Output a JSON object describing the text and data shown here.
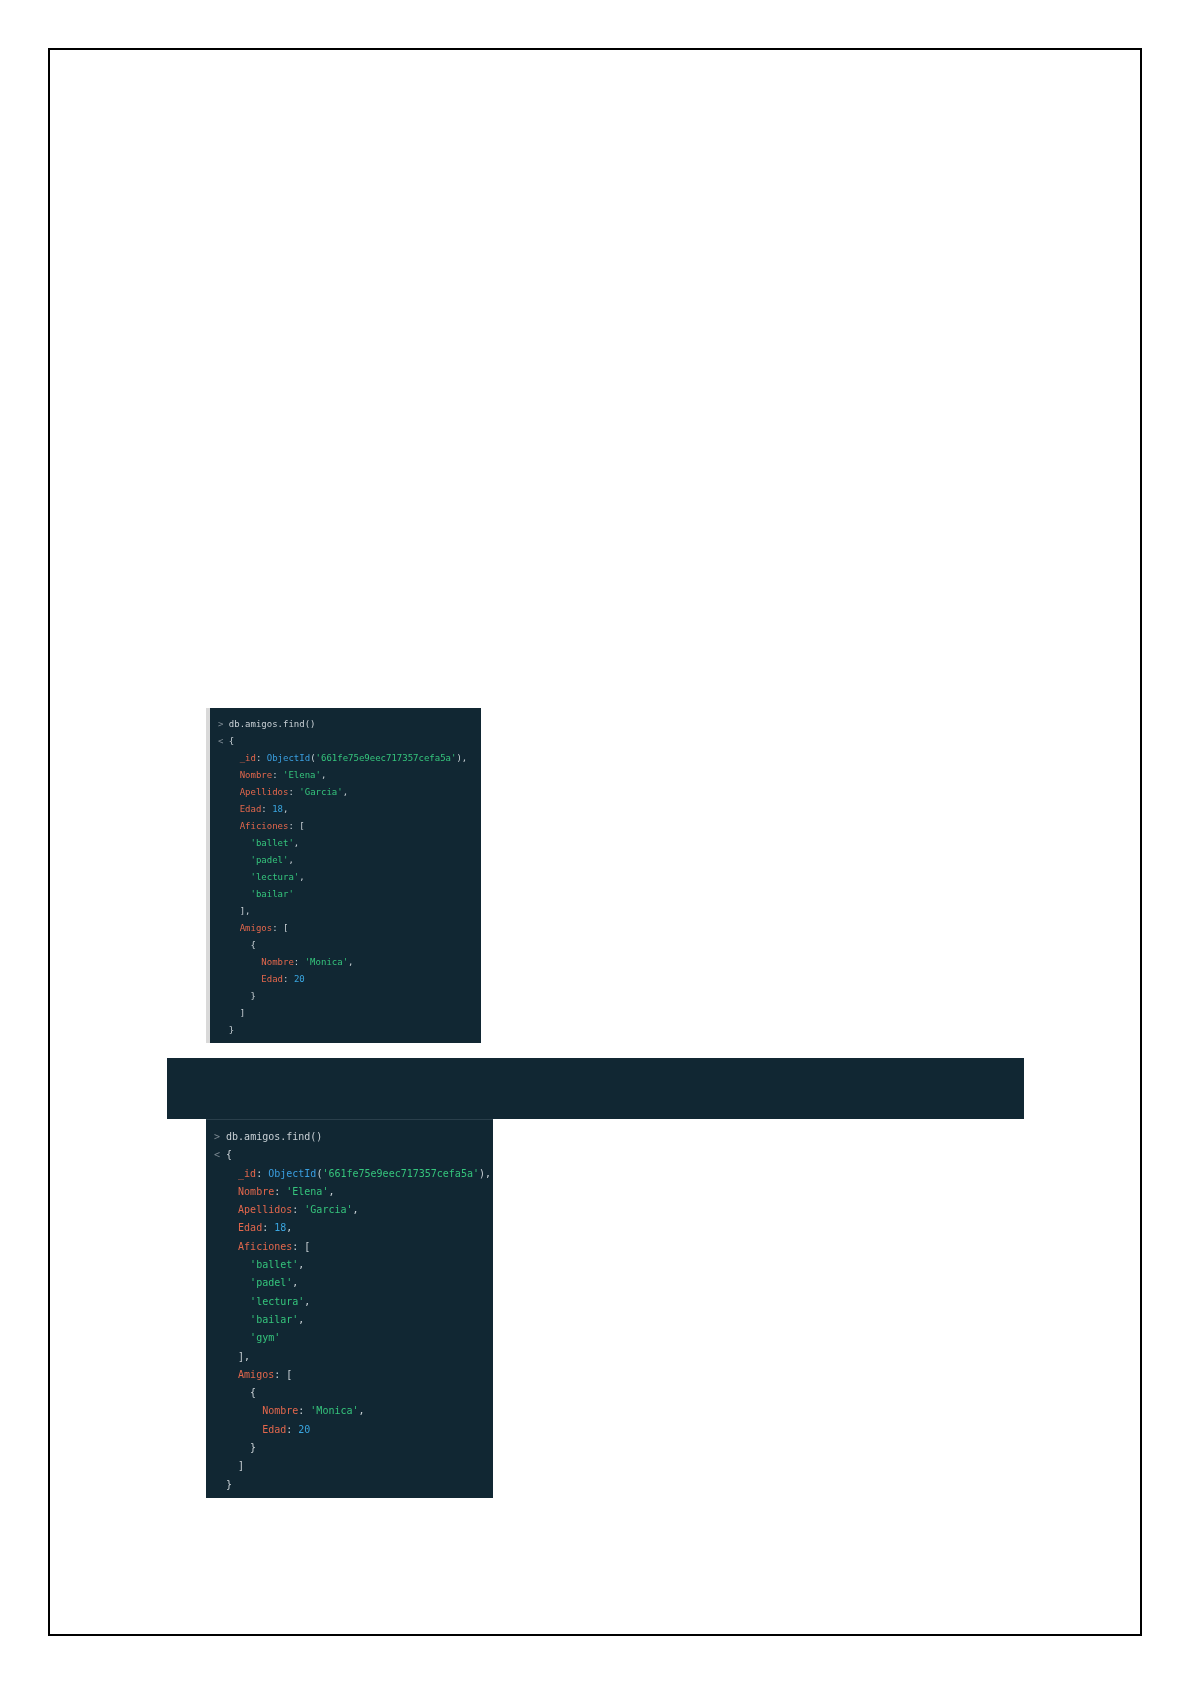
{
  "screenshots": [
    {
      "lines": [
        [
          {
            "kind": "prompt",
            "text": ">"
          },
          {
            "kind": "plain",
            "text": " db.amigos.find()"
          }
        ],
        [
          {
            "kind": "prompt",
            "text": "<"
          },
          {
            "kind": "plain",
            "text": " {"
          }
        ],
        [
          {
            "kind": "key",
            "text": "    _id"
          },
          {
            "kind": "plain",
            "text": ": "
          },
          {
            "kind": "func",
            "text": "ObjectId"
          },
          {
            "kind": "plain",
            "text": "("
          },
          {
            "kind": "string",
            "text": "'661fe75e9eec717357cefa5a'"
          },
          {
            "kind": "plain",
            "text": "),"
          }
        ],
        [
          {
            "kind": "key",
            "text": "    Nombre"
          },
          {
            "kind": "plain",
            "text": ": "
          },
          {
            "kind": "string",
            "text": "'Elena'"
          },
          {
            "kind": "plain",
            "text": ","
          }
        ],
        [
          {
            "kind": "key",
            "text": "    Apellidos"
          },
          {
            "kind": "plain",
            "text": ": "
          },
          {
            "kind": "string",
            "text": "'Garcia'"
          },
          {
            "kind": "plain",
            "text": ","
          }
        ],
        [
          {
            "kind": "key",
            "text": "    Edad"
          },
          {
            "kind": "plain",
            "text": ": "
          },
          {
            "kind": "number",
            "text": "18"
          },
          {
            "kind": "plain",
            "text": ","
          }
        ],
        [
          {
            "kind": "key",
            "text": "    Aficiones"
          },
          {
            "kind": "plain",
            "text": ": ["
          }
        ],
        [
          {
            "kind": "string",
            "text": "      'ballet'"
          },
          {
            "kind": "plain",
            "text": ","
          }
        ],
        [
          {
            "kind": "string",
            "text": "      'padel'"
          },
          {
            "kind": "plain",
            "text": ","
          }
        ],
        [
          {
            "kind": "string",
            "text": "      'lectura'"
          },
          {
            "kind": "plain",
            "text": ","
          }
        ],
        [
          {
            "kind": "string",
            "text": "      'bailar'"
          }
        ],
        [
          {
            "kind": "plain",
            "text": "    ],"
          }
        ],
        [
          {
            "kind": "key",
            "text": "    Amigos"
          },
          {
            "kind": "plain",
            "text": ": ["
          }
        ],
        [
          {
            "kind": "plain",
            "text": "      {"
          }
        ],
        [
          {
            "kind": "key",
            "text": "        Nombre"
          },
          {
            "kind": "plain",
            "text": ": "
          },
          {
            "kind": "string",
            "text": "'Monica'"
          },
          {
            "kind": "plain",
            "text": ","
          }
        ],
        [
          {
            "kind": "key",
            "text": "        Edad"
          },
          {
            "kind": "plain",
            "text": ": "
          },
          {
            "kind": "number",
            "text": "20"
          }
        ],
        [
          {
            "kind": "plain",
            "text": "      }"
          }
        ],
        [
          {
            "kind": "plain",
            "text": "    ]"
          }
        ],
        [
          {
            "kind": "plain",
            "text": "  }"
          }
        ]
      ]
    },
    {
      "lines": [
        [
          {
            "kind": "prompt",
            "text": ">"
          },
          {
            "kind": "plain",
            "text": " db.amigos.find()"
          }
        ],
        [
          {
            "kind": "prompt",
            "text": "<"
          },
          {
            "kind": "plain",
            "text": " {"
          }
        ],
        [
          {
            "kind": "key",
            "text": "    _id"
          },
          {
            "kind": "plain",
            "text": ": "
          },
          {
            "kind": "func",
            "text": "ObjectId"
          },
          {
            "kind": "plain",
            "text": "("
          },
          {
            "kind": "string",
            "text": "'661fe75e9eec717357cefa5a'"
          },
          {
            "kind": "plain",
            "text": "),"
          }
        ],
        [
          {
            "kind": "key",
            "text": "    Nombre"
          },
          {
            "kind": "plain",
            "text": ": "
          },
          {
            "kind": "string",
            "text": "'Elena'"
          },
          {
            "kind": "plain",
            "text": ","
          }
        ],
        [
          {
            "kind": "key",
            "text": "    Apellidos"
          },
          {
            "kind": "plain",
            "text": ": "
          },
          {
            "kind": "string",
            "text": "'Garcia'"
          },
          {
            "kind": "plain",
            "text": ","
          }
        ],
        [
          {
            "kind": "key",
            "text": "    Edad"
          },
          {
            "kind": "plain",
            "text": ": "
          },
          {
            "kind": "number",
            "text": "18"
          },
          {
            "kind": "plain",
            "text": ","
          }
        ],
        [
          {
            "kind": "key",
            "text": "    Aficiones"
          },
          {
            "kind": "plain",
            "text": ": ["
          }
        ],
        [
          {
            "kind": "string",
            "text": "      'ballet'"
          },
          {
            "kind": "plain",
            "text": ","
          }
        ],
        [
          {
            "kind": "string",
            "text": "      'padel'"
          },
          {
            "kind": "plain",
            "text": ","
          }
        ],
        [
          {
            "kind": "string",
            "text": "      'lectura'"
          },
          {
            "kind": "plain",
            "text": ","
          }
        ],
        [
          {
            "kind": "string",
            "text": "      'bailar'"
          },
          {
            "kind": "plain",
            "text": ","
          }
        ],
        [
          {
            "kind": "string",
            "text": "      'gym'"
          }
        ],
        [
          {
            "kind": "plain",
            "text": "    ],"
          }
        ],
        [
          {
            "kind": "key",
            "text": "    Amigos"
          },
          {
            "kind": "plain",
            "text": ": ["
          }
        ],
        [
          {
            "kind": "plain",
            "text": "      {"
          }
        ],
        [
          {
            "kind": "key",
            "text": "        Nombre"
          },
          {
            "kind": "plain",
            "text": ": "
          },
          {
            "kind": "string",
            "text": "'Monica'"
          },
          {
            "kind": "plain",
            "text": ","
          }
        ],
        [
          {
            "kind": "key",
            "text": "        Edad"
          },
          {
            "kind": "plain",
            "text": ": "
          },
          {
            "kind": "number",
            "text": "20"
          }
        ],
        [
          {
            "kind": "plain",
            "text": "      }"
          }
        ],
        [
          {
            "kind": "plain",
            "text": "    ]"
          }
        ],
        [
          {
            "kind": "plain",
            "text": "  }"
          }
        ]
      ]
    }
  ]
}
